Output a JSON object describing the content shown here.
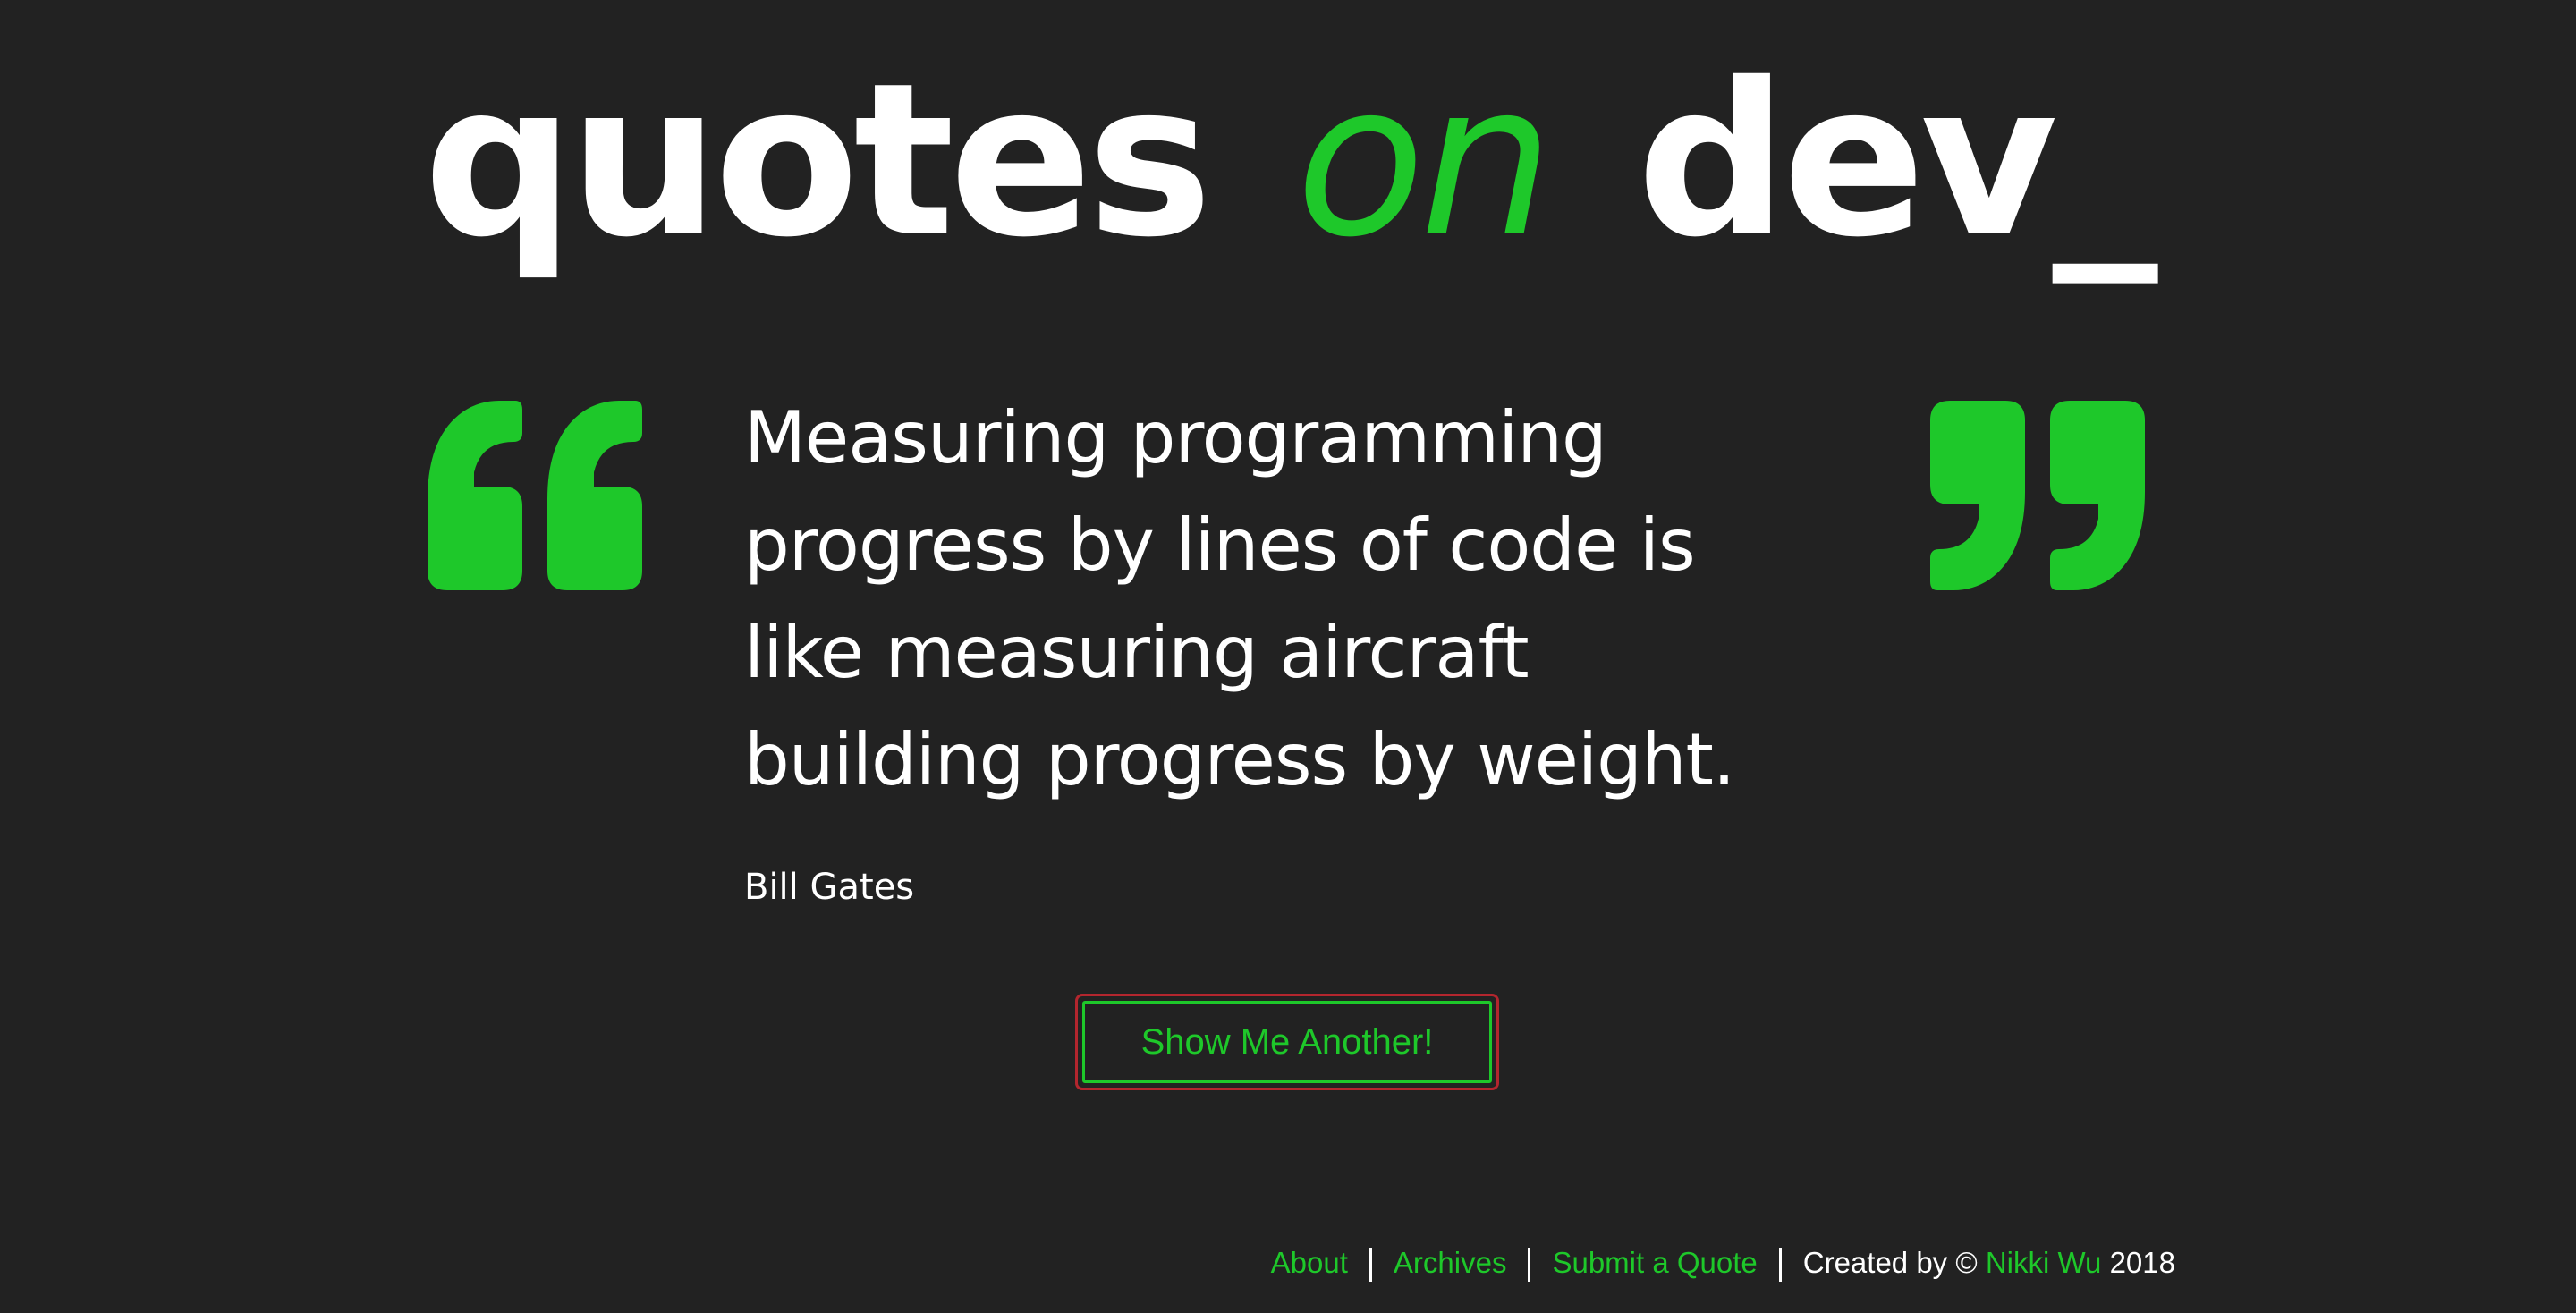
{
  "header": {
    "title_part1": "quotes",
    "title_part2": "on",
    "title_part3": "dev_"
  },
  "quote": {
    "text": "Measuring programming progress by lines of code is like measuring aircraft building progress by weight.",
    "author": "Bill Gates"
  },
  "actions": {
    "show_another_label": "Show Me Another!"
  },
  "footer": {
    "links": [
      "About",
      "Archives",
      "Submit a Quote"
    ],
    "credit_prefix": "Created by ©",
    "credit_name": "Nikki Wu",
    "credit_year": "2018"
  },
  "colors": {
    "background": "#222222",
    "accent": "#1ec82a",
    "text": "#ffffff",
    "focus_ring": "#b3262e"
  },
  "icons": {
    "open_quote": "left-double-quote-icon",
    "close_quote": "right-double-quote-icon"
  }
}
